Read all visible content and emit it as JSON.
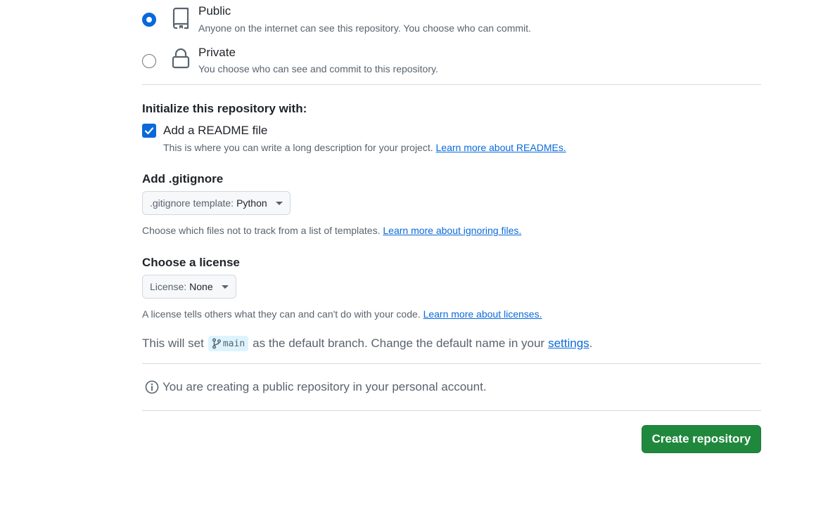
{
  "visibility": {
    "public": {
      "title": "Public",
      "description": "Anyone on the internet can see this repository. You choose who can commit.",
      "selected": true,
      "icon": "repo-icon"
    },
    "private": {
      "title": "Private",
      "description": "You choose who can see and commit to this repository.",
      "selected": false,
      "icon": "lock-icon"
    }
  },
  "initialize": {
    "heading": "Initialize this repository with:",
    "readme": {
      "label": "Add a README file",
      "checked": true,
      "help": "This is where you can write a long description for your project.",
      "link": "Learn more about READMEs."
    }
  },
  "gitignore": {
    "heading": "Add .gitignore",
    "select_label": ".gitignore template:",
    "select_value": "Python",
    "help": "Choose which files not to track from a list of templates.",
    "link": "Learn more about ignoring files."
  },
  "license": {
    "heading": "Choose a license",
    "select_label": "License:",
    "select_value": "None",
    "help": "A license tells others what they can and can't do with your code.",
    "link": "Learn more about licenses."
  },
  "branch": {
    "prefix": "This will set",
    "branch_name": "main",
    "suffix": "as the default branch. Change the default name in your",
    "link": "settings",
    "end": "."
  },
  "info": {
    "message": "You are creating a public repository in your personal account."
  },
  "create_button": {
    "label": "Create repository"
  },
  "colors": {
    "accent": "#0969da",
    "primary_button": "#1f883d",
    "muted_text": "#59636e",
    "border": "#d1d9e0"
  }
}
